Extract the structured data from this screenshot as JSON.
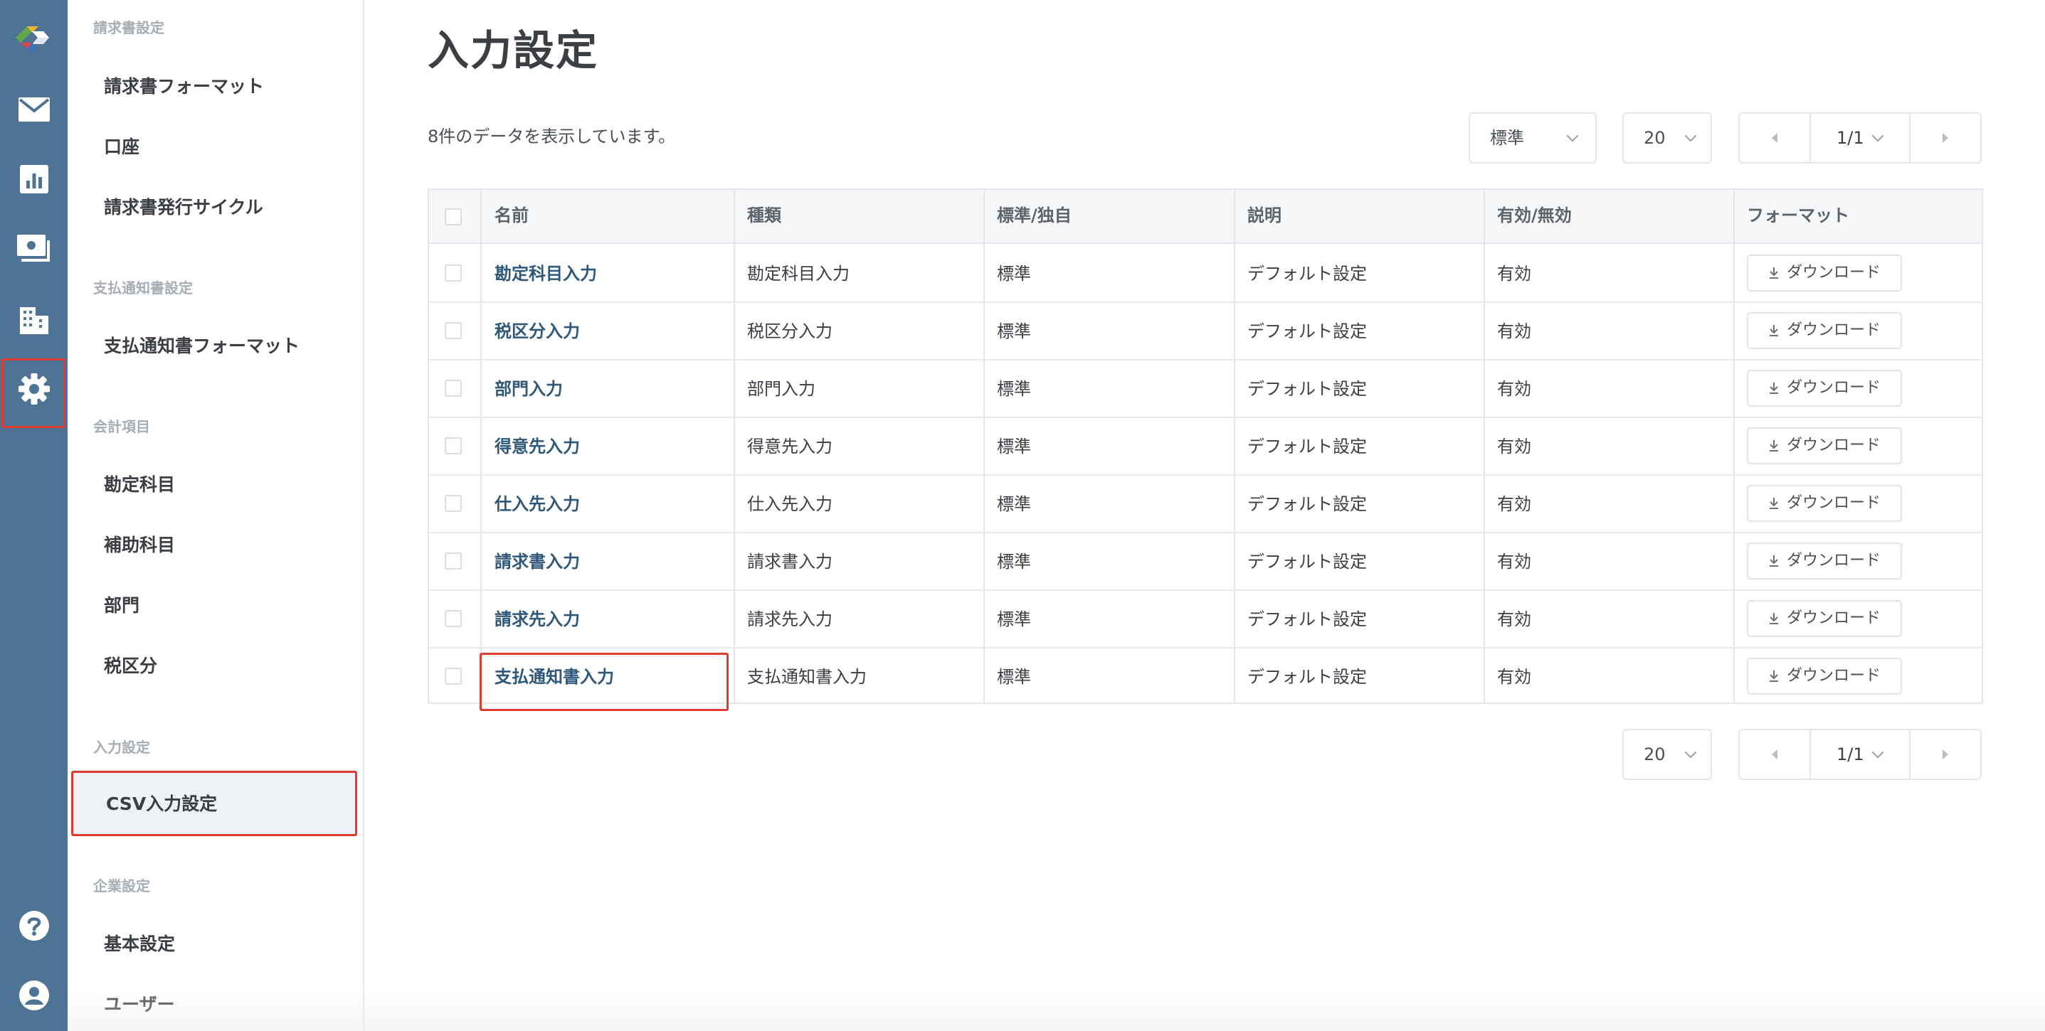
{
  "rail": {
    "icons": [
      {
        "name": "mail-icon"
      },
      {
        "name": "chart-icon"
      },
      {
        "name": "payment-icon"
      },
      {
        "name": "building-icon"
      },
      {
        "name": "gear-icon"
      },
      {
        "name": "help-icon"
      },
      {
        "name": "user-icon"
      }
    ]
  },
  "sidebar": {
    "sections": [
      {
        "title": "請求書設定",
        "items": [
          "請求書フォーマット",
          "口座",
          "請求書発行サイクル"
        ]
      },
      {
        "title": "支払通知書設定",
        "items": [
          "支払通知書フォーマット"
        ]
      },
      {
        "title": "会計項目",
        "items": [
          "勘定科目",
          "補助科目",
          "部門",
          "税区分"
        ]
      },
      {
        "title": "入力設定",
        "items": [
          "CSV入力設定"
        ]
      },
      {
        "title": "企業設定",
        "items": [
          "基本設定",
          "ユーザー"
        ]
      }
    ],
    "active_item": "CSV入力設定"
  },
  "main": {
    "title": "入力設定",
    "data_count": "8件のデータを表示しています。",
    "filter_select": "標準",
    "per_page": "20",
    "page_indicator": "1/1",
    "bottom_per_page": "20",
    "bottom_page_indicator": "1/1"
  },
  "table": {
    "headers": [
      "名前",
      "種類",
      "標準/独自",
      "説明",
      "有効/無効",
      "フォーマット"
    ],
    "rows": [
      {
        "name": "勘定科目入力",
        "type": "勘定科目入力",
        "std": "標準",
        "desc": "デフォルト設定",
        "status": "有効",
        "action": "ダウンロード"
      },
      {
        "name": "税区分入力",
        "type": "税区分入力",
        "std": "標準",
        "desc": "デフォルト設定",
        "status": "有効",
        "action": "ダウンロード"
      },
      {
        "name": "部門入力",
        "type": "部門入力",
        "std": "標準",
        "desc": "デフォルト設定",
        "status": "有効",
        "action": "ダウンロード"
      },
      {
        "name": "得意先入力",
        "type": "得意先入力",
        "std": "標準",
        "desc": "デフォルト設定",
        "status": "有効",
        "action": "ダウンロード"
      },
      {
        "name": "仕入先入力",
        "type": "仕入先入力",
        "std": "標準",
        "desc": "デフォルト設定",
        "status": "有効",
        "action": "ダウンロード"
      },
      {
        "name": "請求書入力",
        "type": "請求書入力",
        "std": "標準",
        "desc": "デフォルト設定",
        "status": "有効",
        "action": "ダウンロード"
      },
      {
        "name": "請求先入力",
        "type": "請求先入力",
        "std": "標準",
        "desc": "デフォルト設定",
        "status": "有効",
        "action": "ダウンロード"
      },
      {
        "name": "支払通知書入力",
        "type": "支払通知書入力",
        "std": "標準",
        "desc": "デフォルト設定",
        "status": "有効",
        "action": "ダウンロード"
      }
    ]
  },
  "colors": {
    "rail_bg": "#4f7395",
    "highlight": "#e03b2f",
    "link": "#2f5778"
  }
}
